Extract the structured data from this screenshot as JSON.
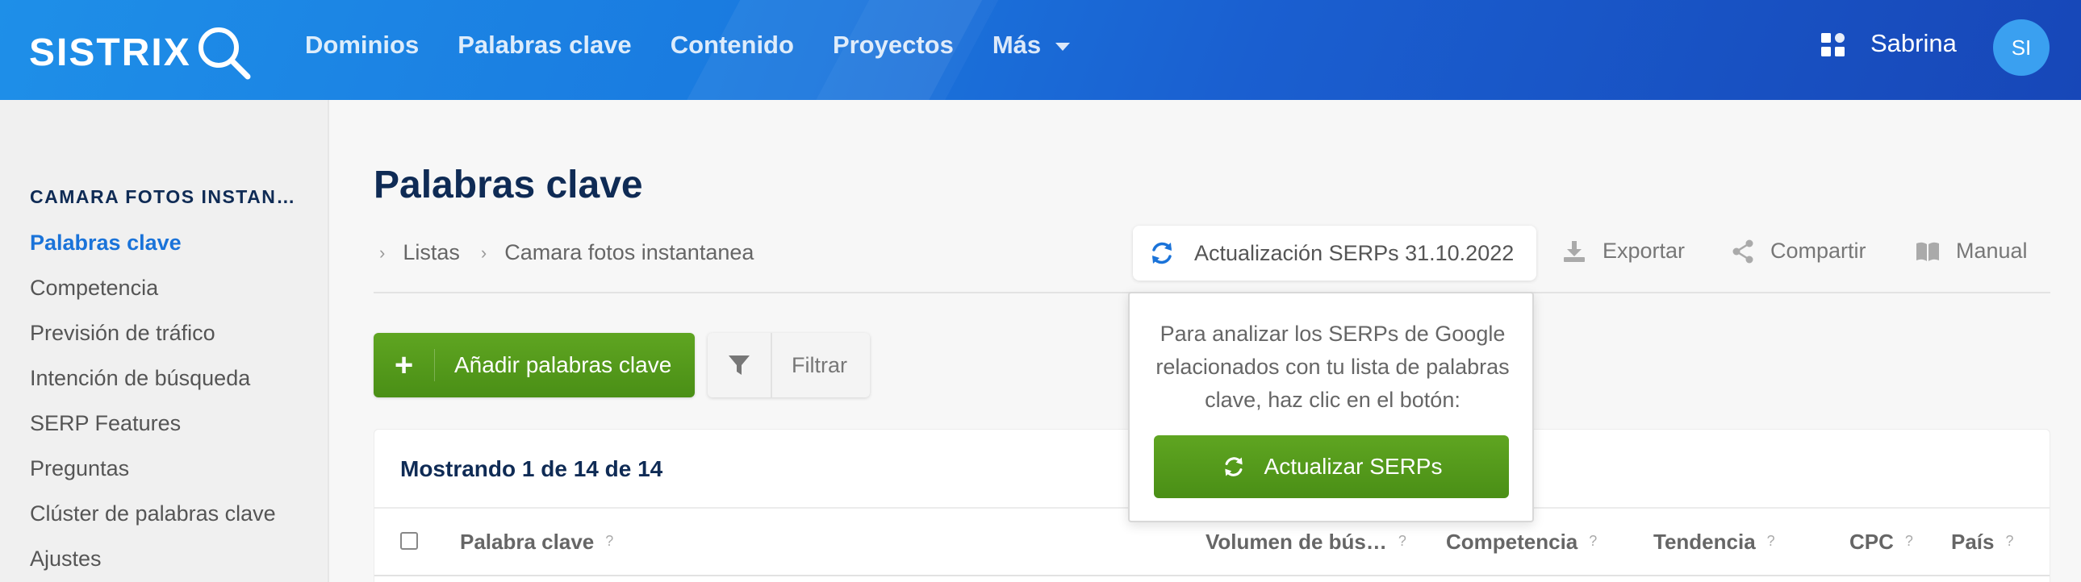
{
  "header": {
    "logo": "SISTRIX",
    "nav": [
      "Dominios",
      "Palabras clave",
      "Contenido",
      "Proyectos",
      "Más"
    ],
    "user_name": "Sabrina",
    "avatar_initials": "SI"
  },
  "sidebar": {
    "project": "CAMARA FOTOS INSTAN…",
    "items": [
      "Palabras clave",
      "Competencia",
      "Previsión de tráfico",
      "Intención de búsqueda",
      "SERP Features",
      "Preguntas",
      "Clúster de palabras clave",
      "Ajustes"
    ],
    "active_index": 0
  },
  "main": {
    "title": "Palabras clave",
    "breadcrumb": [
      "Listas",
      "Camara fotos instantanea"
    ],
    "serp_update_label": "Actualización SERPs 31.10.2022",
    "tools": {
      "export": "Exportar",
      "share": "Compartir",
      "manual": "Manual"
    },
    "add_keywords_label": "Añadir palabras clave",
    "filter_label": "Filtrar"
  },
  "table": {
    "summary": "Mostrando 1 de 14 de 14",
    "columns": [
      "Palabra clave",
      "Volumen de bús…",
      "Competencia",
      "Tendencia",
      "CPC",
      "País"
    ],
    "help_mark": "?"
  },
  "popover": {
    "text": "Para analizar los SERPs de Google relacionados con tu lista de palabras clave, haz clic en el botón:",
    "button_label": "Actualizar SERPs"
  },
  "colors": {
    "brand_blue": "#1a7be0",
    "primary_green": "#4e9419",
    "title_navy": "#0f2b55",
    "active_link": "#1a73d9"
  },
  "icons": {
    "logo": "magnifier-icon",
    "nav_more": "chevron-down-icon",
    "apps": "apps-grid-icon",
    "serp_update": "refresh-icon",
    "export": "download-icon",
    "share": "share-icon",
    "manual": "book-icon",
    "add": "plus-icon",
    "filter": "funnel-icon",
    "breadcrumb_sep": "chevron-right-icon"
  }
}
